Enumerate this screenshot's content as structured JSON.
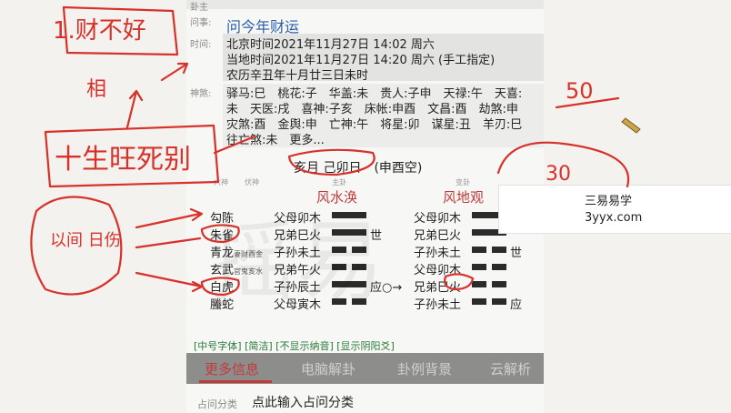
{
  "panel": {
    "top_label": "卦主",
    "question_label": "问事:",
    "question": "问今年财运",
    "time_label": "时间:",
    "time_lines": [
      "北京时间2021年11月27日 14:02 周六",
      "当地时间2021年11月27日 14:20 周六 (手工指定)",
      "农历辛丑年十月廿三日未时"
    ],
    "shensha_label": "神煞:",
    "shensha_lines": [
      "驿马:巳　桃花:子　华盖:未　贵人:子申　天禄:午　天喜:",
      "未　天医:戌　喜神:子亥　床帐:申酉　文昌:酉　劫煞:申",
      "灾煞:酉　金舆:申　亡神:午　将星:卯　谋星:丑　羊刃:巳",
      "往亡煞:未　更多..."
    ],
    "date_line": "亥月 己卯日　(申酉空)",
    "small_labels": {
      "liushen": "六神",
      "fushen": "伏神",
      "zhugua": "主卦",
      "biangua": "变卦"
    },
    "gua_main": "风水涣",
    "gua_change": "风地观",
    "spirits": [
      {
        "name": "勾陈",
        "extra": ""
      },
      {
        "name": "朱雀",
        "extra": ""
      },
      {
        "name": "青龙",
        "extra": "妻财酉金"
      },
      {
        "name": "玄武",
        "extra": "官鬼亥水"
      },
      {
        "name": "白虎",
        "extra": ""
      },
      {
        "name": "螣蛇",
        "extra": ""
      }
    ],
    "main_yao": [
      "父母卯木",
      "兄弟巳火",
      "子孙未土",
      "兄弟午火",
      "子孙辰土",
      "父母寅木"
    ],
    "main_marks": [
      "",
      "世",
      "",
      "",
      "应○→",
      ""
    ],
    "change_yao": [
      "父母卯木",
      "兄弟巳火",
      "子孙未土",
      "父母卯木",
      "兄弟巳火",
      "子孙未土"
    ],
    "change_marks": [
      "",
      "",
      "世",
      "",
      "",
      "应"
    ],
    "toggles": "[中号字体] [简洁] [不显示纳音] [显示阴阳爻]",
    "tabs": [
      "更多信息",
      "电脑解卦",
      "卦例背景",
      "云解析"
    ],
    "classify_label": "占问分类",
    "classify_placeholder": "点此输入占问分类"
  },
  "popup": {
    "line1": "三易易学",
    "line2": "3yyx.com"
  },
  "watermark": "摇易",
  "handwriting": {
    "top_left": "1.财不好",
    "tin": "相",
    "middle": "十生旺死别",
    "bottom_left": "以间 日伤",
    "num50": "50",
    "num30": "30"
  }
}
